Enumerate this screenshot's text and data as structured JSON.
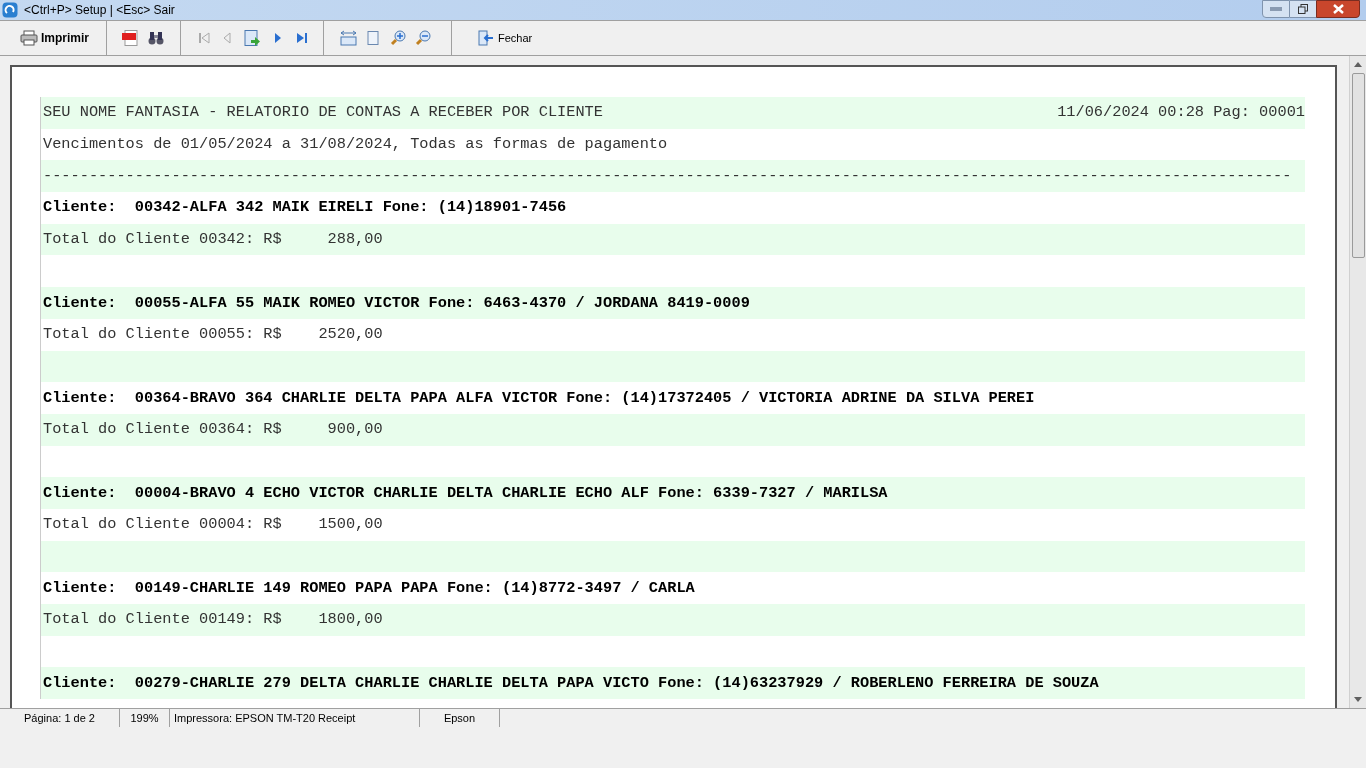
{
  "window": {
    "title": "<Ctrl+P> Setup | <Esc> Sair"
  },
  "toolbar": {
    "print": "Imprimir",
    "close": "Fechar"
  },
  "report": {
    "lines": [
      {
        "kind": "header",
        "text": "SEU NOME FANTASIA - RELATORIO DE CONTAS A RECEBER POR CLIENTE",
        "right": "11/06/2024 00:28 Pag: 00001"
      },
      {
        "kind": "plain",
        "text": "Vencimentos de 01/05/2024 a 31/08/2024, Todas as formas de pagamento"
      },
      {
        "kind": "plain",
        "text": "----------------------------------------------------------------------------------------------------------------------------------------"
      },
      {
        "kind": "client",
        "text": "Cliente:  00342-ALFA 342 MAIK EIRELI Fone: (14)18901-7456"
      },
      {
        "kind": "plain",
        "text": "Total do Cliente 00342: R$     288,00"
      },
      {
        "kind": "blank"
      },
      {
        "kind": "client",
        "text": "Cliente:  00055-ALFA 55 MAIK ROMEO VICTOR Fone: 6463-4370 / JORDANA 8419-0009"
      },
      {
        "kind": "plain",
        "text": "Total do Cliente 00055: R$    2520,00"
      },
      {
        "kind": "blank"
      },
      {
        "kind": "client",
        "text": "Cliente:  00364-BRAVO 364 CHARLIE DELTA PAPA ALFA VICTOR Fone: (14)17372405 / VICTORIA ADRINE DA SILVA PEREI"
      },
      {
        "kind": "plain",
        "text": "Total do Cliente 00364: R$     900,00"
      },
      {
        "kind": "blank"
      },
      {
        "kind": "client",
        "text": "Cliente:  00004-BRAVO 4 ECHO VICTOR CHARLIE DELTA CHARLIE ECHO ALF Fone: 6339-7327 / MARILSA"
      },
      {
        "kind": "plain",
        "text": "Total do Cliente 00004: R$    1500,00"
      },
      {
        "kind": "blank"
      },
      {
        "kind": "client",
        "text": "Cliente:  00149-CHARLIE 149 ROMEO PAPA PAPA Fone: (14)8772-3497 / CARLA"
      },
      {
        "kind": "plain",
        "text": "Total do Cliente 00149: R$    1800,00"
      },
      {
        "kind": "blank"
      },
      {
        "kind": "client",
        "text": "Cliente:  00279-CHARLIE 279 DELTA CHARLIE CHARLIE DELTA PAPA VICTO Fone: (14)63237929 / ROBERLENO FERREIRA DE SOUZA"
      }
    ]
  },
  "status_bar": [
    "Página: 1 de 2",
    "199%",
    "Impressora: EPSON TM-T20 Receipt",
    "Epson"
  ]
}
